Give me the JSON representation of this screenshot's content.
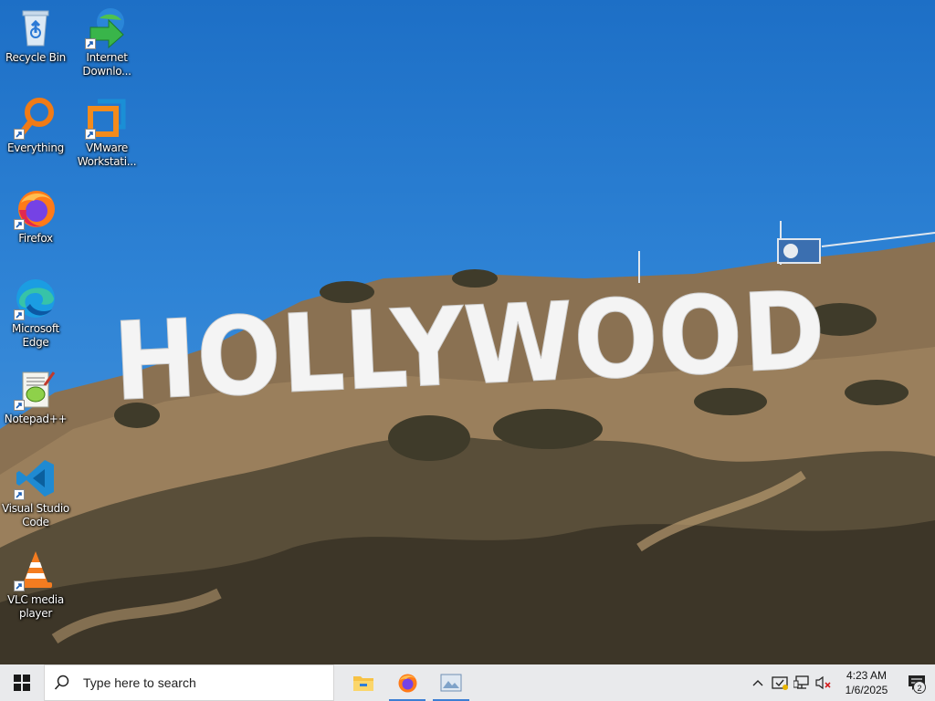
{
  "wallpaper": {
    "sign_text": "HOLLYWOOD",
    "sky_color": "#2f84d6",
    "hill_color": "#7d6a4f"
  },
  "desktop": {
    "icons": [
      {
        "label": "Recycle Bin",
        "icon": "recycle-bin-icon",
        "shortcut": false
      },
      {
        "label": "Internet\nDownlo...",
        "icon": "internet-download-manager-icon",
        "shortcut": true
      },
      {
        "label": "Everything",
        "icon": "everything-search-icon",
        "shortcut": true
      },
      {
        "label": "VMware\nWorkstati...",
        "icon": "vmware-workstation-icon",
        "shortcut": true
      },
      {
        "label": "Firefox",
        "icon": "firefox-icon",
        "shortcut": true
      },
      {
        "label": "Microsoft\nEdge",
        "icon": "edge-icon",
        "shortcut": true
      },
      {
        "label": "Notepad++",
        "icon": "notepad-plus-plus-icon",
        "shortcut": true
      },
      {
        "label": "Visual Studio\nCode",
        "icon": "vscode-icon",
        "shortcut": true
      },
      {
        "label": "VLC media\nplayer",
        "icon": "vlc-icon",
        "shortcut": true
      }
    ]
  },
  "taskbar": {
    "start_icon": "windows-logo-icon",
    "search": {
      "placeholder": "Type here to search"
    },
    "pinned": [
      {
        "name": "File Explorer",
        "icon": "file-explorer-icon",
        "running": false
      },
      {
        "name": "Firefox",
        "icon": "firefox-icon",
        "running": true
      },
      {
        "name": "Photos",
        "icon": "photos-icon",
        "running": true
      }
    ],
    "tray": {
      "icons": [
        "chevron-up-icon",
        "security-icon",
        "network-icon",
        "volume-muted-icon"
      ],
      "time": "4:23 AM",
      "date": "1/6/2025",
      "notification_count": "2"
    },
    "accent_color": "#3c7fd3"
  }
}
